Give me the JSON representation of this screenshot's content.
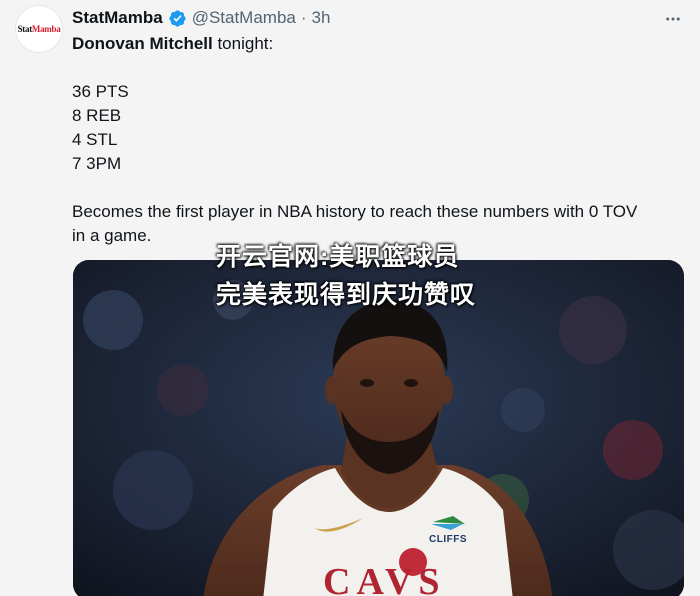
{
  "tweet": {
    "avatar_logo": {
      "part1": "Stat",
      "part2": "Mamba"
    },
    "display_name": "StatMamba",
    "handle": "@StatMamba",
    "separator": "·",
    "time": "3h",
    "lines": {
      "player": "Donovan Mitchell",
      "intro_rest": " tonight:",
      "stat1": "36 PTS",
      "stat2": "8 REB",
      "stat3": "4 STL",
      "stat4": "7 3PM",
      "closing1": "Becomes the first player in NBA history to reach these numbers with 0 TOV",
      "closing2": "in a game."
    },
    "media": {
      "jersey_logo": "CLIFFS",
      "jersey_letters": "CAVS"
    }
  },
  "overlay": {
    "line1": "开云官网:美职篮球员",
    "line2": "完美表现得到庆功赞叹"
  },
  "colors": {
    "verified": "#1d9bf0",
    "secondary_text": "#536471",
    "primary_text": "#0f1419",
    "brand_red": "#d1202f"
  }
}
